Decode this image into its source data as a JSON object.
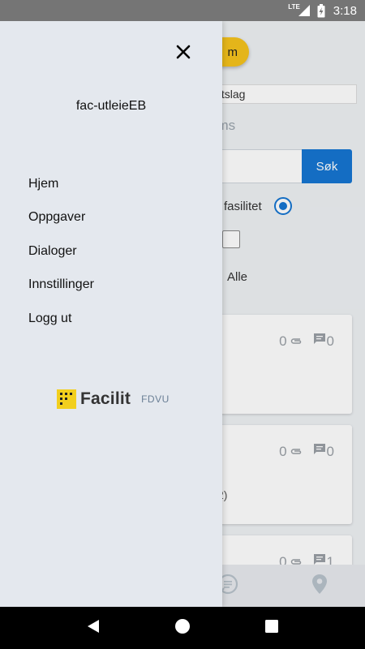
{
  "status_bar": {
    "network": "LTE",
    "time": "3:18"
  },
  "background": {
    "header_button_label": "m",
    "filter_label": "ttslag",
    "items_heading": "ems",
    "search_button_label": "Søk",
    "radio_option_label": "fasilitet",
    "filter_all_label": "Alle",
    "cards": [
      {
        "attachments": "0",
        "comments": "0",
        "extra": ""
      },
      {
        "attachments": "0",
        "comments": "0",
        "extra": "2)"
      },
      {
        "attachments": "0",
        "comments": "1",
        "extra": ""
      }
    ]
  },
  "drawer": {
    "user": "fac-utleieEB",
    "menu": [
      {
        "label": "Hjem"
      },
      {
        "label": "Oppgaver"
      },
      {
        "label": "Dialoger"
      },
      {
        "label": "Innstillinger"
      },
      {
        "label": "Logg ut"
      }
    ],
    "logo_name": "Facilit",
    "logo_sub": "FDVU"
  },
  "bottom_nav": {
    "items": [
      "home-icon",
      "gear-icon",
      "chat-icon",
      "location-pin-icon"
    ],
    "active_color": "#1676d2",
    "inactive_color": "#b9c3cc"
  },
  "colors": {
    "accent": "#1676d2",
    "yellow": "#f6c31c",
    "drawer_bg": "#e4e8ee"
  }
}
